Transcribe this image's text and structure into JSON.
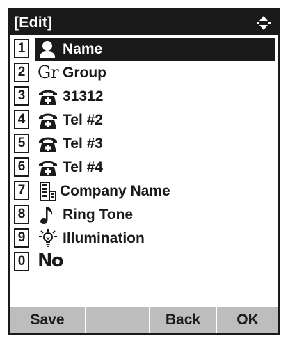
{
  "header": {
    "title": "[Edit]",
    "nav_icon": "up-down-arrow-icon"
  },
  "menu": {
    "selected_index": 0,
    "items": [
      {
        "number": "1",
        "icon": "person-icon",
        "label": "Name"
      },
      {
        "number": "2",
        "icon": "group-gr-icon",
        "icon_text": "Gr",
        "label": "Group"
      },
      {
        "number": "3",
        "icon": "telephone-icon",
        "label": "31312"
      },
      {
        "number": "4",
        "icon": "telephone-icon",
        "label": "Tel #2"
      },
      {
        "number": "5",
        "icon": "telephone-icon",
        "label": "Tel #3"
      },
      {
        "number": "6",
        "icon": "telephone-icon",
        "label": "Tel #4"
      },
      {
        "number": "7",
        "icon": "building-icon",
        "label": "Company Name"
      },
      {
        "number": "8",
        "icon": "music-note-icon",
        "label": "Ring Tone"
      },
      {
        "number": "9",
        "icon": "light-bulb-icon",
        "label": "Illumination"
      },
      {
        "number": "0",
        "icon": "number-no-icon",
        "icon_text": "No",
        "label": ""
      }
    ]
  },
  "softkeys": {
    "key1": "Save",
    "key2": "",
    "key3": "Back",
    "key4": "OK"
  },
  "colors": {
    "foreground": "#1a1a1a",
    "background": "#ffffff",
    "softkey_bar": "#bdbdbd"
  }
}
